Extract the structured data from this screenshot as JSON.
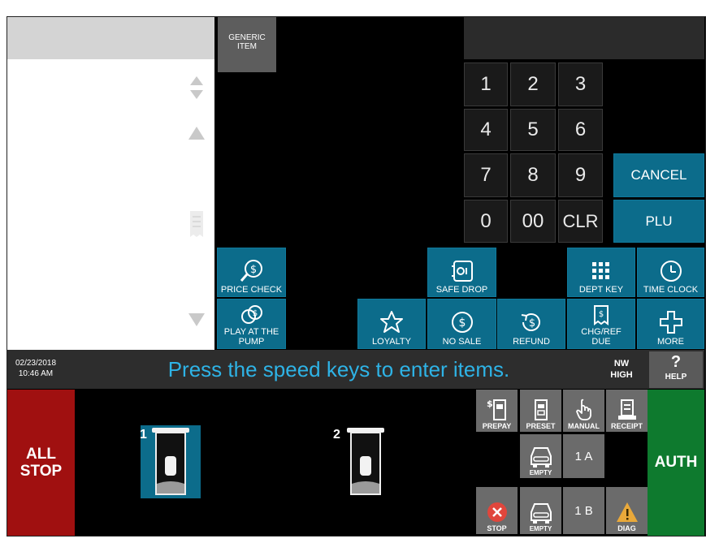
{
  "generic_item": "GENERIC\nITEM",
  "numpad": {
    "keys": [
      "1",
      "2",
      "3",
      "4",
      "5",
      "6",
      "7",
      "8",
      "9",
      "0",
      "00",
      "CLR"
    ],
    "cancel": "CANCEL",
    "plu": "PLU"
  },
  "function_keys": {
    "price_check": "PRICE CHECK",
    "safe_drop": "SAFE DROP",
    "dept_key": "DEPT KEY",
    "time_clock": "TIME CLOCK",
    "play_at_pump": "PLAY AT THE PUMP",
    "loyalty": "LOYALTY",
    "no_sale": "NO SALE",
    "refund": "REFUND",
    "chg_ref_due": "CHG/REF DUE",
    "more": "MORE"
  },
  "status_bar": {
    "date": "02/23/2018",
    "time": "10:46 AM",
    "message": "Press the speed keys to enter items.",
    "nw": "NW",
    "high": "HIGH",
    "help_icon": "?",
    "help": "HELP"
  },
  "pumps": {
    "all_stop": "ALL\nSTOP",
    "pump1_number": "1",
    "pump2_number": "2",
    "prepay": "PREPAY",
    "preset": "PRESET",
    "manual": "MANUAL",
    "receipt": "RECEIPT",
    "empty_a": "EMPTY",
    "slot_a": "1 A",
    "empty_b": "EMPTY",
    "slot_b": "1 B",
    "stop": "STOP",
    "diag": "DIAG",
    "auth": "AUTH"
  },
  "colors": {
    "teal": "#0c6c8b",
    "all_stop_red": "#a01010",
    "auth_green": "#0e7a2e",
    "status_text": "#2eb3e6"
  }
}
